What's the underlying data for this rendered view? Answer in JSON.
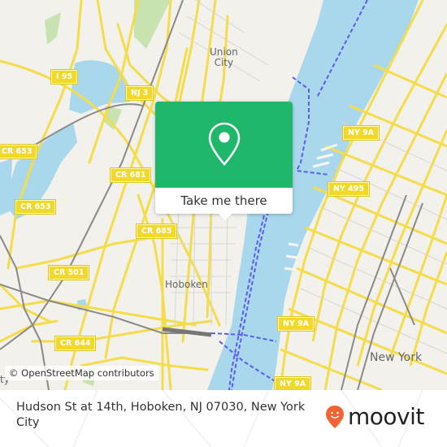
{
  "map": {
    "place_labels": [
      {
        "id": "union-city",
        "text": "Union\nCity"
      },
      {
        "id": "hoboken",
        "text": "Hoboken"
      },
      {
        "id": "new-york",
        "text": "New York"
      },
      {
        "id": "city-partial",
        "text": "ty"
      }
    ],
    "road_shields": [
      {
        "id": "i95",
        "text": "I 95"
      },
      {
        "id": "nj3",
        "text": "NJ 3"
      },
      {
        "id": "cr653-a",
        "text": "CR 653"
      },
      {
        "id": "cr681",
        "text": "CR 681"
      },
      {
        "id": "cr653-b",
        "text": "CR 653"
      },
      {
        "id": "cr685",
        "text": "CR 685"
      },
      {
        "id": "cr501",
        "text": "CR 501"
      },
      {
        "id": "cr644",
        "text": "CR 644"
      },
      {
        "id": "ny9a-a",
        "text": "NY 9A"
      },
      {
        "id": "ny495",
        "text": "NY 495"
      },
      {
        "id": "ny9a-b",
        "text": "NY 9A"
      },
      {
        "id": "ny9a-c",
        "text": "NY 9A"
      }
    ],
    "attribution": "© OpenStreetMap contributors",
    "colors": {
      "land": "#f2f1ec",
      "water": "#a9d8ec",
      "road": "#f5dc4a",
      "rail": "#8a8a8a",
      "park": "#c8e2b0",
      "ferry": "#5b5bf0"
    }
  },
  "popup": {
    "icon": "map-pin-icon",
    "button_label": "Take me there",
    "accent": "#1fb86a"
  },
  "footer": {
    "address": "Hudson St at 14th, Hoboken, NJ 07030, New York City",
    "brand": "moovit",
    "brand_icon": "moovit-pin-logo-icon",
    "brand_color": "#f26532"
  }
}
